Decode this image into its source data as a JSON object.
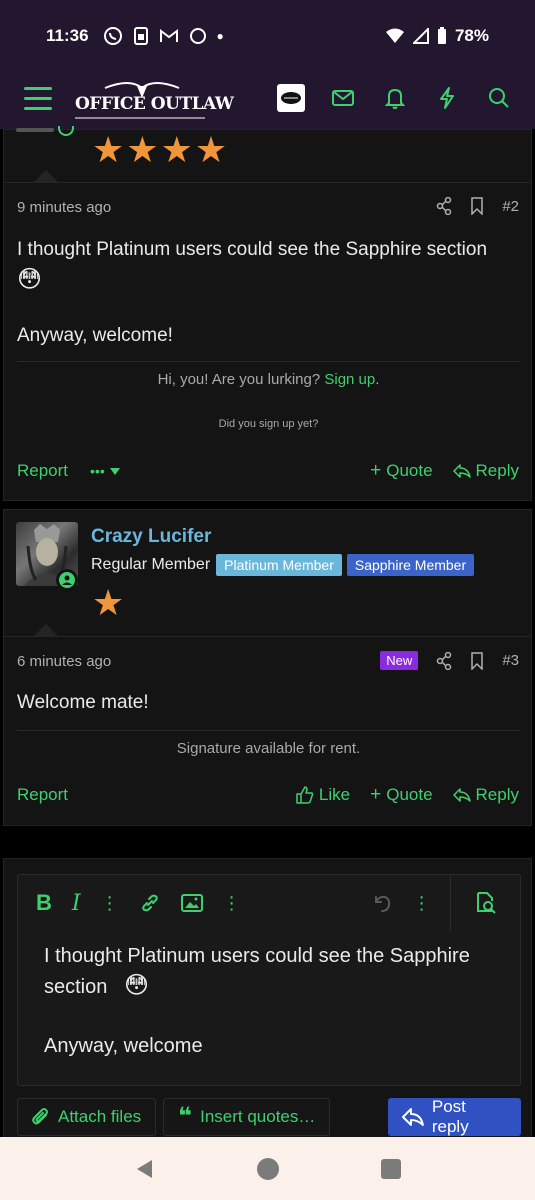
{
  "status_bar": {
    "time": "11:36",
    "battery": "78%"
  },
  "header": {
    "logo_text": "OFFICE OUTLAW",
    "accent": "#3ed06e"
  },
  "post1": {
    "timestamp": "9 minutes ago",
    "number": "#2",
    "body_line1": "I thought Platinum users could see the Sapphire section",
    "body_emoji": "😳",
    "body_line2": "Anyway, welcome!",
    "sig_line1_pre": "Hi, you! Are you lurking?",
    "sig_line1_link": "Sign up",
    "sig_line1_post": ".",
    "sig_line2": "Did you sign up yet?",
    "report": "Report",
    "more": "•••",
    "quote": "Quote",
    "reply": "Reply"
  },
  "post2": {
    "username": "Crazy Lucifer",
    "user_title": "Regular Member",
    "badge1": "Platinum Member",
    "badge2": "Sapphire Member",
    "timestamp": "6 minutes ago",
    "new_badge": "New",
    "number": "#3",
    "body": "Welcome mate!",
    "signature": "Signature available for rent.",
    "report": "Report",
    "like": "Like",
    "quote": "Quote",
    "reply": "Reply"
  },
  "editor": {
    "text_line1": "I thought Platinum users could see the Sapphire",
    "text_line2": "section",
    "text_emoji": "😳",
    "text_line3": "Anyway, welcome",
    "attach_label": "Attach files",
    "insert_label": "Insert quotes…",
    "post_label": "Post reply"
  }
}
